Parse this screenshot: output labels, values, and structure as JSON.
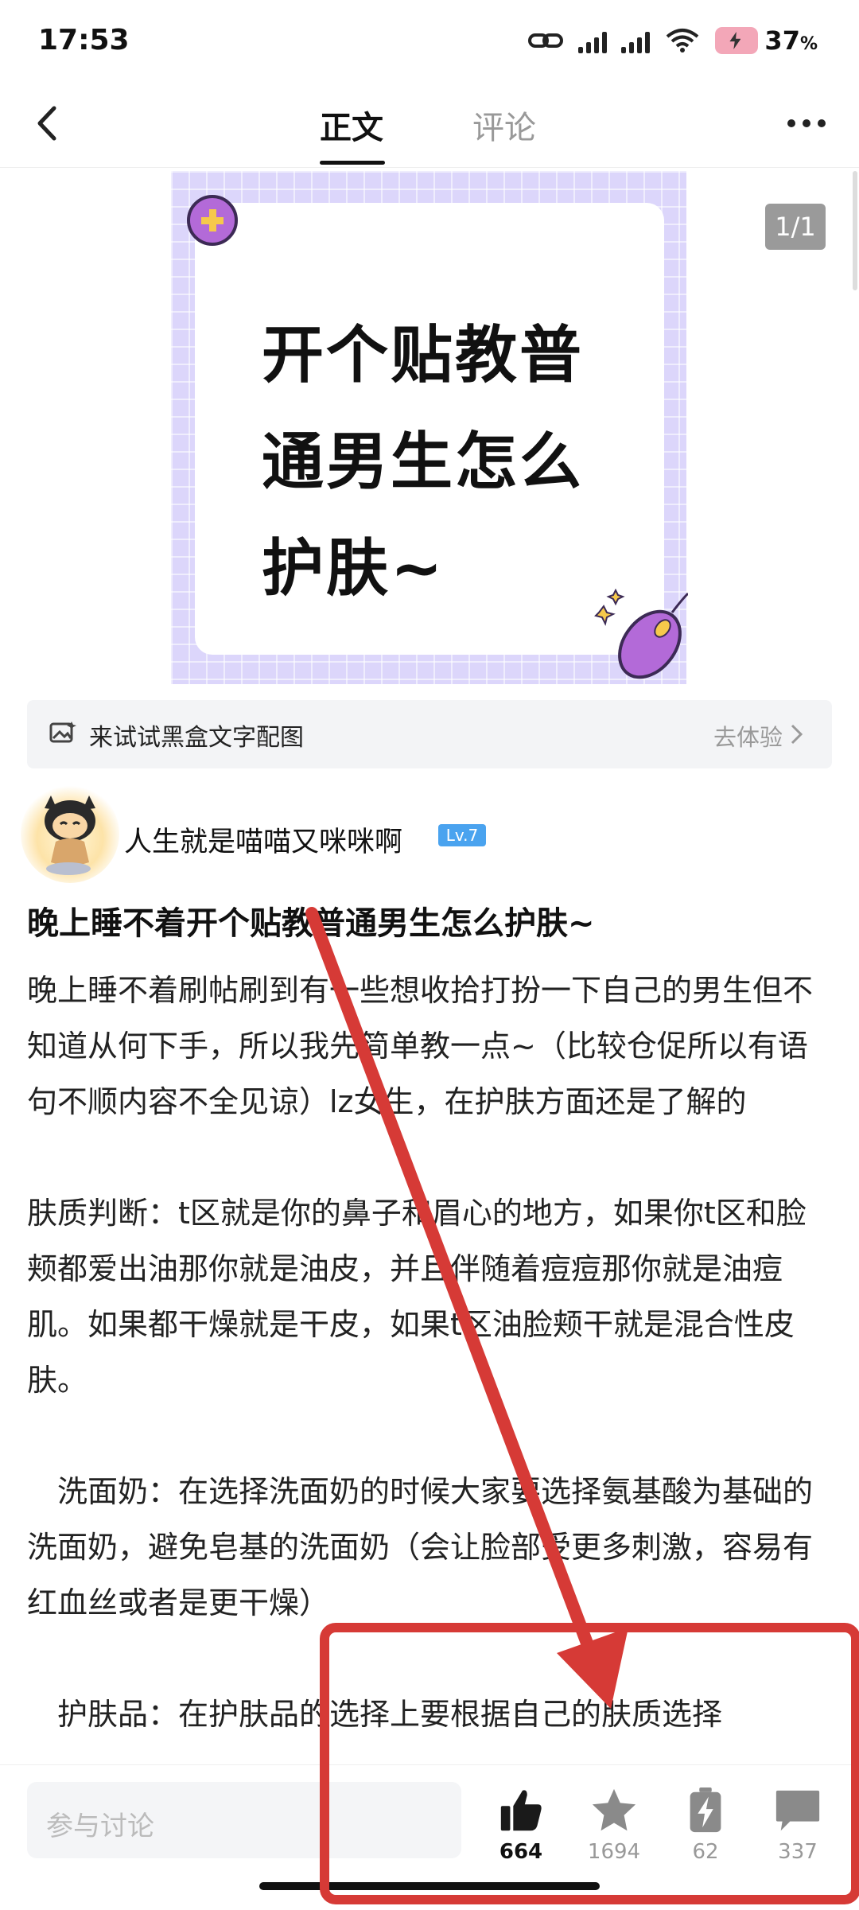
{
  "status_bar": {
    "time": "17:53",
    "battery": "37",
    "battery_unit": "%"
  },
  "nav": {
    "tabs": [
      "正文",
      "评论"
    ],
    "active_tab": "正文"
  },
  "image": {
    "lines": [
      "开个贴教普",
      "通男生怎么",
      "护肤~"
    ],
    "counter": "1/1"
  },
  "promo": {
    "text": "来试试黑盒文字配图",
    "cta": "去体验"
  },
  "author": {
    "name": "人生就是喵喵又咪咪啊",
    "level": "Lv.7"
  },
  "post": {
    "title": "晚上睡不着开个贴教普通男生怎么护肤~",
    "paragraphs": [
      "晚上睡不着刷帖刷到有一些想收拾打扮一下自己的男生但不知道从何下手，所以我先简单教一点~（比较仓促所以有语句不顺内容不全见谅）lz女生，在护肤方面还是了解的",
      "肤质判断：t区就是你的鼻子和眉心的地方，如果你t区和脸颊都爱出油那你就是油皮，并且伴随着痘痘那你就是油痘肌。如果都干燥就是干皮，如果t区油脸颊干就是混合性皮肤。",
      "　洗面奶：在选择洗面奶的时候大家要选择氨基酸为基础的洗面奶，避免皂基的洗面奶（会让脸部受更多刺激，容易有红血丝或者是更干燥）",
      "　护肤品：在护肤品的选择上要根据自己的肤质选择"
    ]
  },
  "bottom_bar": {
    "placeholder": "参与讨论",
    "likes": "664",
    "favorites": "1694",
    "charges": "62",
    "comments": "337"
  },
  "colors": {
    "annotation": "#d63a36",
    "level_badge": "#4aa3ef",
    "hero_bg": "#dcd6fb"
  }
}
